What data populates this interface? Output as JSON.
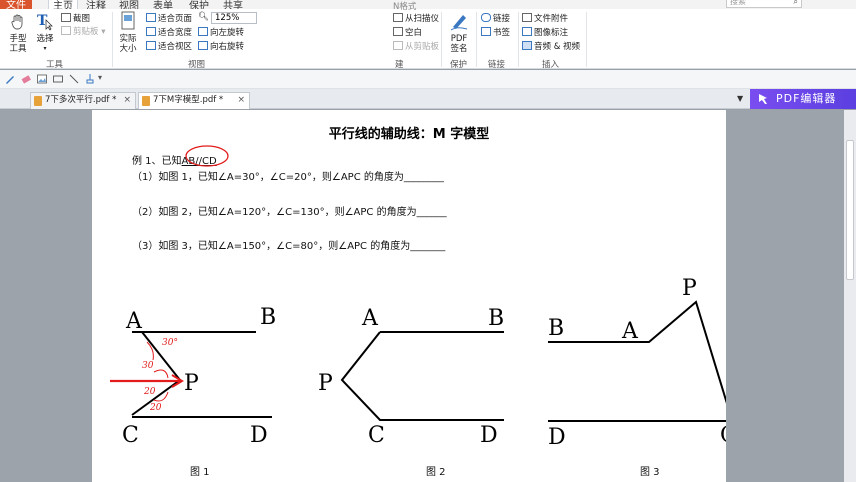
{
  "menu_tabs": [
    "文件",
    "主页",
    "注释",
    "视图",
    "表单",
    "保护",
    "共享"
  ],
  "search": {
    "placeholder": "搜索"
  },
  "ribbon": {
    "hand_tool": {
      "line1": "手型",
      "line2": "工具"
    },
    "select": "选择",
    "screenshot": "截图",
    "clipboard": "剪贴板",
    "tools_group": "工具",
    "actual_size": {
      "line1": "实际",
      "line2": "大小"
    },
    "fit_page": "适合页面",
    "fit_width": "适合宽度",
    "fit_visible": "适合视区",
    "zoom": "125%",
    "rotate_left": "向左旋转",
    "rotate_right": "向右旋转",
    "view_group": "视图",
    "format_btn": "N格式",
    "from_scanner": "从扫描仪",
    "blank": "空白",
    "from_clipboard": "从剪贴板",
    "create_group": "建",
    "pdf_sign": {
      "line1": "PDF",
      "line2": "签名"
    },
    "protect_group": "保护",
    "link": "链接",
    "bookmark": "书签",
    "link_group": "链接",
    "file_attach": "文件附件",
    "image_annot": "图像标注",
    "audio_video": "音频 & 视频",
    "insert_group": "插入"
  },
  "doc_tabs": [
    {
      "label": "7下多次平行.pdf *"
    },
    {
      "label": "7下M字模型.pdf *"
    }
  ],
  "pdf_editor_label": "PDF编辑器",
  "document": {
    "title": "平行线的辅助线：M 字模型",
    "example_prefix": "例 1、已知",
    "example_given": "AB//CD",
    "q1": "（1）如图 1，已知∠A=30°，∠C=20°，则∠APC 的角度为________",
    "q2": "（2）如图 2，已知∠A=120°，∠C=130°，则∠APC 的角度为______",
    "q3": "（3）如图 3，已知∠A=150°，∠C=80°，则∠APC 的角度为_______",
    "fig_labels": [
      "图 1",
      "图 2",
      "图 3"
    ],
    "fig1_points": {
      "A": "A",
      "B": "B",
      "P": "P",
      "C": "C",
      "D": "D"
    },
    "fig2_points": {
      "A": "A",
      "B": "B",
      "P": "P",
      "C": "C",
      "D": "D"
    },
    "fig3_points": {
      "B": "B",
      "A": "A",
      "P": "P",
      "D": "D",
      "C": "C"
    },
    "annotations": {
      "a1": "30°",
      "a2": "30",
      "a3": "20",
      "a4": "20"
    }
  },
  "colors": {
    "accent": "#d9532c",
    "editor": "#6a47ea",
    "ink": "#e21b1b"
  }
}
